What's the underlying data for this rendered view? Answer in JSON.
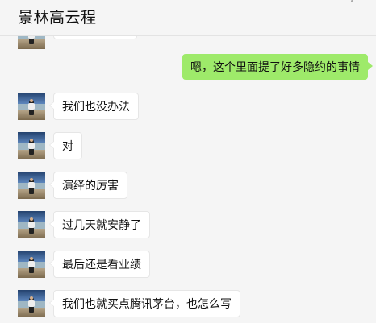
{
  "header": {
    "title": "景林高云程"
  },
  "messages": [
    {
      "direction": "out",
      "text": "嗯，这个里面提了好多隐约的事情"
    },
    {
      "direction": "in",
      "text": "我们也没办法"
    },
    {
      "direction": "in",
      "text": "对"
    },
    {
      "direction": "in",
      "text": "演绎的厉害"
    },
    {
      "direction": "in",
      "text": "过几天就安静了"
    },
    {
      "direction": "in",
      "text": "最后还是看业绩"
    },
    {
      "direction": "in",
      "text": "我们也就买点腾讯茅台，也怎么写"
    }
  ],
  "colors": {
    "background": "#f5f5f5",
    "outgoing_bubble": "#9eea6a",
    "incoming_bubble": "#ffffff"
  }
}
